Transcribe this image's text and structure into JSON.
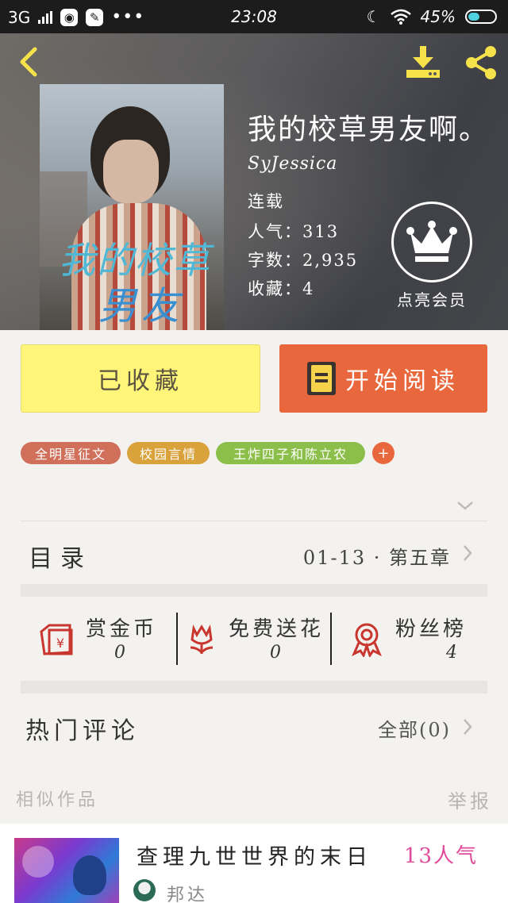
{
  "status_bar": {
    "network": "3G",
    "time": "23:08",
    "battery": "45%",
    "icons": [
      "signal-icon",
      "message-icon",
      "paint-icon",
      "more-dots-icon",
      "moon-icon",
      "wifi-icon",
      "battery-icon"
    ]
  },
  "header": {
    "back_icon": "chevron-left-icon",
    "download_icon": "download-icon",
    "share_icon": "share-icon"
  },
  "book": {
    "title": "我的校草男友啊。",
    "author": "SyJessica",
    "status": "连载",
    "popularity_label": "人气：",
    "popularity": "313",
    "words_label": "字数：",
    "words": "2,935",
    "favorites_label": "收藏：",
    "favorites": "4",
    "cover_caption_1": "我的校草",
    "cover_caption_2": "男友"
  },
  "vip": {
    "icon": "crown-icon",
    "label": "点亮会员"
  },
  "actions": {
    "favorite_label": "已收藏",
    "read_label": "开始阅读"
  },
  "tags": [
    {
      "label": "全明星征文",
      "color": "#d0705a"
    },
    {
      "label": "校园言情",
      "color": "#d9a23a"
    },
    {
      "label": "王炸四子和陈立农",
      "color": "#8cbf4a"
    },
    {
      "label": "+",
      "color": "#e9673c"
    }
  ],
  "catalog": {
    "label": "目录",
    "latest": "01-13 · 第五章"
  },
  "stats": [
    {
      "name": "赏金币",
      "value": "0",
      "icon": "red-envelope-icon"
    },
    {
      "name": "免费送花",
      "value": "0",
      "icon": "flower-icon"
    },
    {
      "name": "粉丝榜",
      "value": "4",
      "icon": "medal-icon"
    }
  ],
  "comments": {
    "label": "热门评论",
    "all": "全部(0)"
  },
  "similar": {
    "heading": "相似作品",
    "report": "举报",
    "items": [
      {
        "title": "查理九世世界的末日",
        "popularity": "13人气",
        "author": "邦达"
      }
    ]
  },
  "colors": {
    "accent_orange": "#e9673c",
    "favorite_yellow": "#fff578",
    "popularity_pink": "#e04a9a"
  }
}
